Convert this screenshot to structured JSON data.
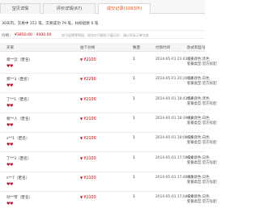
{
  "tabs": [
    {
      "label": "宝贝详情"
    },
    {
      "label": "评价详情(67)"
    },
    {
      "label": "成交记录(1093件)"
    }
  ],
  "summary": "30天内，交易中 151 笔，交易成功 79 笔，纠纷退款 0 笔",
  "price_row": {
    "label": "价格：",
    "range": "¥3850.00 - 4300.00",
    "note": "由于促销等原因，成交价可能低于展示价，请以实际订单为准"
  },
  "table": {
    "headers": [
      "买家",
      "拍下价格",
      "数量",
      "付款时间",
      "款式和型号"
    ],
    "rows": [
      {
        "buyer": "章**云（匿名）",
        "price": "¥2100",
        "qty": "1",
        "time": "2014-05-01 23:41:27",
        "spec": [
          "机身颜色:黑色",
          "套餐类型:官方标配"
        ]
      },
      {
        "buyer": "郭**3（匿名）",
        "price": "¥2290",
        "qty": "1",
        "time": "2014-05-01 20:20:34",
        "spec": [
          "机身颜色:白色",
          "套餐类型:官方标配"
        ]
      },
      {
        "buyer": "丁**1（匿名）",
        "price": "¥2100",
        "qty": "1",
        "time": "2014-05-01 18:43:59",
        "spec": [
          "机身颜色:黑色",
          "套餐类型:官方标配"
        ]
      },
      {
        "buyer": "黎**人（匿名）",
        "price": "¥2100",
        "qty": "1",
        "time": "2014-05-01 18:19:48",
        "spec": [
          "机身颜色:白色",
          "套餐类型:官方标配"
        ]
      },
      {
        "buyer": "x**1（匿名）",
        "price": "¥2100",
        "qty": "1",
        "time": "2014-05-01 18:08:35",
        "spec": [
          "机身颜色:白色",
          "套餐类型:官方标配"
        ]
      },
      {
        "buyer": "丁**3（匿名）",
        "price": "¥2100",
        "qty": "1",
        "time": "2014-05-01 17:59:24",
        "spec": [
          "机身颜色:白色",
          "套餐类型:官方标配"
        ]
      },
      {
        "buyer": "s**7（匿名）",
        "price": "¥2100",
        "qty": "1",
        "time": "2014-05-01 17:40:45",
        "spec": [
          "机身颜色:白色",
          "套餐类型:官方标配"
        ]
      },
      {
        "buyer": "孙**赞（匿名）",
        "price": "¥2100",
        "qty": "1",
        "time": "2014-05-01 17:04:29",
        "spec": [
          "机身颜色:白色",
          "套餐类型:官方标配"
        ]
      }
    ]
  },
  "reputation_icon": "heart-reputation-icon",
  "colors": {
    "accent": "#e4540f",
    "price": "#c40000",
    "hearts": "#d4002a"
  }
}
